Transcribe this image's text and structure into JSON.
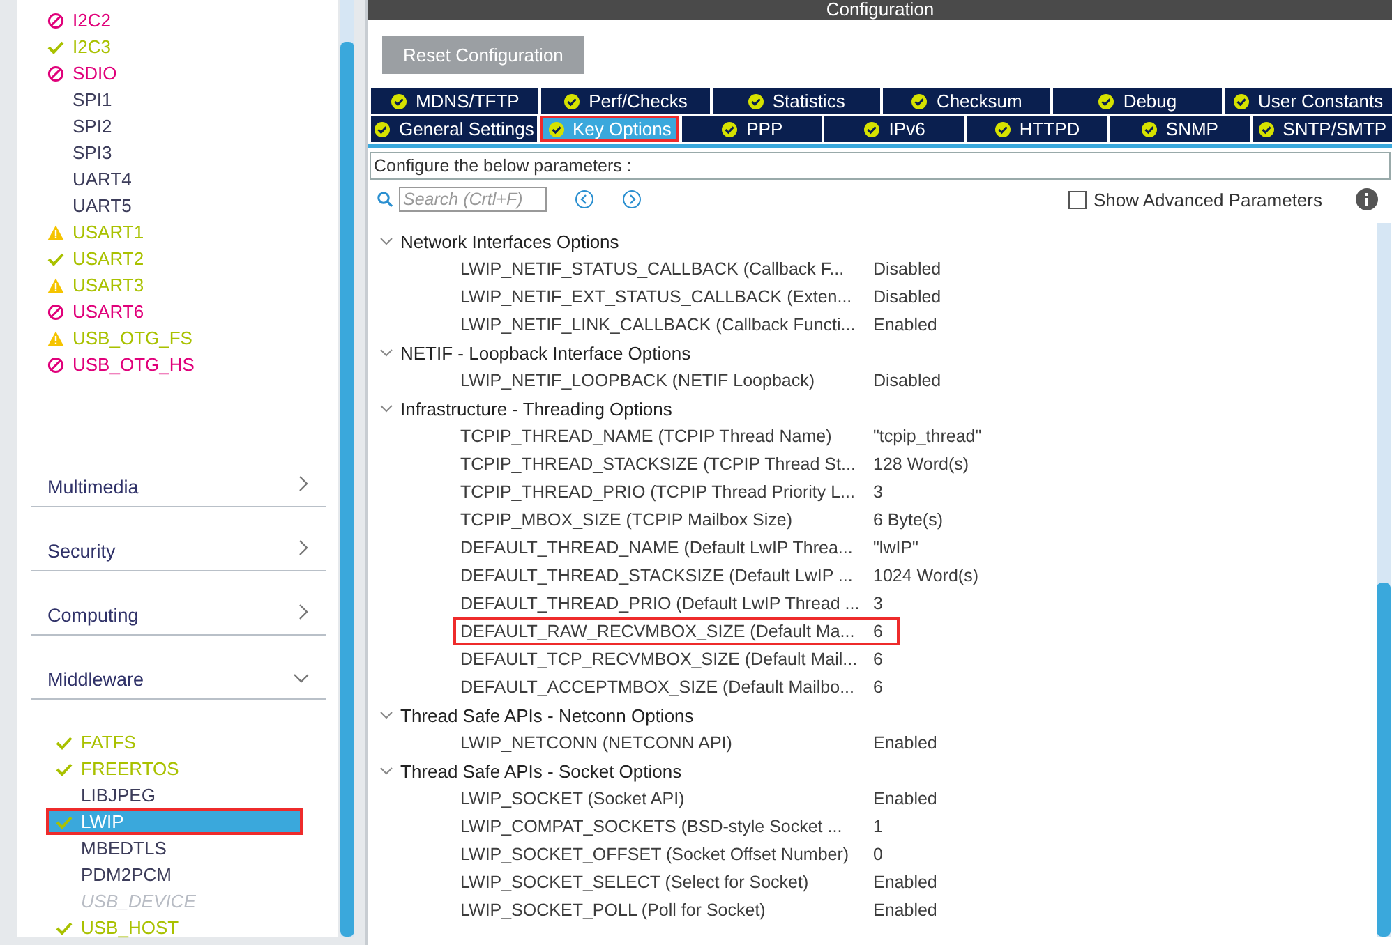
{
  "peripherals": [
    {
      "label": "I2C2",
      "kind": "error"
    },
    {
      "label": "I2C3",
      "kind": "ok"
    },
    {
      "label": "SDIO",
      "kind": "error"
    },
    {
      "label": "SPI1",
      "kind": "plain"
    },
    {
      "label": "SPI2",
      "kind": "plain"
    },
    {
      "label": "SPI3",
      "kind": "plain"
    },
    {
      "label": "UART4",
      "kind": "plain"
    },
    {
      "label": "UART5",
      "kind": "plain"
    },
    {
      "label": "USART1",
      "kind": "warning"
    },
    {
      "label": "USART2",
      "kind": "ok"
    },
    {
      "label": "USART3",
      "kind": "warning"
    },
    {
      "label": "USART6",
      "kind": "error"
    },
    {
      "label": "USB_OTG_FS",
      "kind": "warning"
    },
    {
      "label": "USB_OTG_HS",
      "kind": "error"
    }
  ],
  "categories": [
    {
      "label": "Multimedia",
      "expanded": false
    },
    {
      "label": "Security",
      "expanded": false
    },
    {
      "label": "Computing",
      "expanded": false
    },
    {
      "label": "Middleware",
      "expanded": true
    }
  ],
  "middleware": [
    {
      "label": "FATFS",
      "kind": "ok",
      "selected": false,
      "highlighted": false
    },
    {
      "label": "FREERTOS",
      "kind": "ok",
      "selected": false,
      "highlighted": false
    },
    {
      "label": "LIBJPEG",
      "kind": "plain",
      "selected": false,
      "highlighted": false
    },
    {
      "label": "LWIP",
      "kind": "ok",
      "selected": true,
      "highlighted": true
    },
    {
      "label": "MBEDTLS",
      "kind": "plain",
      "selected": false,
      "highlighted": false
    },
    {
      "label": "PDM2PCM",
      "kind": "plain",
      "selected": false,
      "highlighted": false
    },
    {
      "label": "USB_DEVICE",
      "kind": "unavailable",
      "selected": false,
      "highlighted": false
    },
    {
      "label": "USB_HOST",
      "kind": "ok",
      "selected": false,
      "highlighted": false
    }
  ],
  "configuration": {
    "title": "Configuration",
    "reset_button": "Reset Configuration",
    "tab_rows": [
      [
        {
          "label": "MDNS/TFTP",
          "selected": false,
          "highlighted": false
        },
        {
          "label": "Perf/Checks",
          "selected": false,
          "highlighted": false
        },
        {
          "label": "Statistics",
          "selected": false,
          "highlighted": false
        },
        {
          "label": "Checksum",
          "selected": false,
          "highlighted": false
        },
        {
          "label": "Debug",
          "selected": false,
          "highlighted": false
        },
        {
          "label": "User Constants",
          "selected": false,
          "highlighted": false
        }
      ],
      [
        {
          "label": "General Settings",
          "selected": false,
          "highlighted": false
        },
        {
          "label": "Key Options",
          "selected": true,
          "highlighted": true
        },
        {
          "label": "PPP",
          "selected": false,
          "highlighted": false
        },
        {
          "label": "IPv6",
          "selected": false,
          "highlighted": false
        },
        {
          "label": "HTTPD",
          "selected": false,
          "highlighted": false
        },
        {
          "label": "SNMP",
          "selected": false,
          "highlighted": false
        },
        {
          "label": "SNTP/SMTP",
          "selected": false,
          "highlighted": false
        }
      ]
    ],
    "hint": "Configure the below parameters :",
    "search": {
      "placeholder": "Search (Crtl+F)"
    },
    "show_advanced": {
      "label": "Show Advanced Parameters",
      "checked": false
    },
    "groups": [
      {
        "title": "Network Interfaces Options",
        "expanded": true,
        "children": [
          {
            "name": "LWIP_NETIF_STATUS_CALLBACK (Callback F...",
            "value": "Disabled",
            "highlighted": false
          },
          {
            "name": "LWIP_NETIF_EXT_STATUS_CALLBACK (Exten...",
            "value": "Disabled",
            "highlighted": false
          },
          {
            "name": "LWIP_NETIF_LINK_CALLBACK (Callback Functi...",
            "value": "Enabled",
            "highlighted": false
          }
        ]
      },
      {
        "title": "NETIF - Loopback Interface Options",
        "expanded": true,
        "children": [
          {
            "name": "LWIP_NETIF_LOOPBACK (NETIF Loopback)",
            "value": "Disabled",
            "highlighted": false
          }
        ]
      },
      {
        "title": "Infrastructure - Threading Options",
        "expanded": true,
        "children": [
          {
            "name": "TCPIP_THREAD_NAME (TCPIP Thread Name)",
            "value": "\"tcpip_thread\"",
            "highlighted": false
          },
          {
            "name": "TCPIP_THREAD_STACKSIZE (TCPIP Thread St...",
            "value": "128 Word(s)",
            "highlighted": false
          },
          {
            "name": "TCPIP_THREAD_PRIO (TCPIP Thread Priority L...",
            "value": "3",
            "highlighted": false
          },
          {
            "name": "TCPIP_MBOX_SIZE (TCPIP Mailbox Size)",
            "value": "6 Byte(s)",
            "highlighted": false
          },
          {
            "name": "DEFAULT_THREAD_NAME (Default LwIP Threa...",
            "value": "\"lwIP\"",
            "highlighted": false
          },
          {
            "name": "DEFAULT_THREAD_STACKSIZE (Default LwIP ...",
            "value": "1024 Word(s)",
            "highlighted": false
          },
          {
            "name": "DEFAULT_THREAD_PRIO (Default LwIP Thread ...",
            "value": "3",
            "highlighted": false
          },
          {
            "name": "DEFAULT_RAW_RECVMBOX_SIZE (Default Ma...",
            "value": "6",
            "highlighted": true
          },
          {
            "name": "DEFAULT_TCP_RECVMBOX_SIZE (Default Mail...",
            "value": "6",
            "highlighted": false
          },
          {
            "name": "DEFAULT_ACCEPTMBOX_SIZE (Default Mailbo...",
            "value": "6",
            "highlighted": false
          }
        ]
      },
      {
        "title": "Thread Safe APIs - Netconn Options",
        "expanded": true,
        "children": [
          {
            "name": "LWIP_NETCONN (NETCONN API)",
            "value": "Enabled",
            "highlighted": false
          }
        ]
      },
      {
        "title": "Thread Safe APIs - Socket Options",
        "expanded": true,
        "children": [
          {
            "name": "LWIP_SOCKET (Socket API)",
            "value": "Enabled",
            "highlighted": false
          },
          {
            "name": "LWIP_COMPAT_SOCKETS (BSD-style Socket ...",
            "value": "1",
            "highlighted": false
          },
          {
            "name": "LWIP_SOCKET_OFFSET (Socket Offset Number)",
            "value": "0",
            "highlighted": false
          },
          {
            "name": "LWIP_SOCKET_SELECT (Select for Socket)",
            "value": "Enabled",
            "highlighted": false
          },
          {
            "name": "LWIP_SOCKET_POLL (Poll for Socket)",
            "value": "Enabled",
            "highlighted": false
          }
        ]
      }
    ]
  }
}
